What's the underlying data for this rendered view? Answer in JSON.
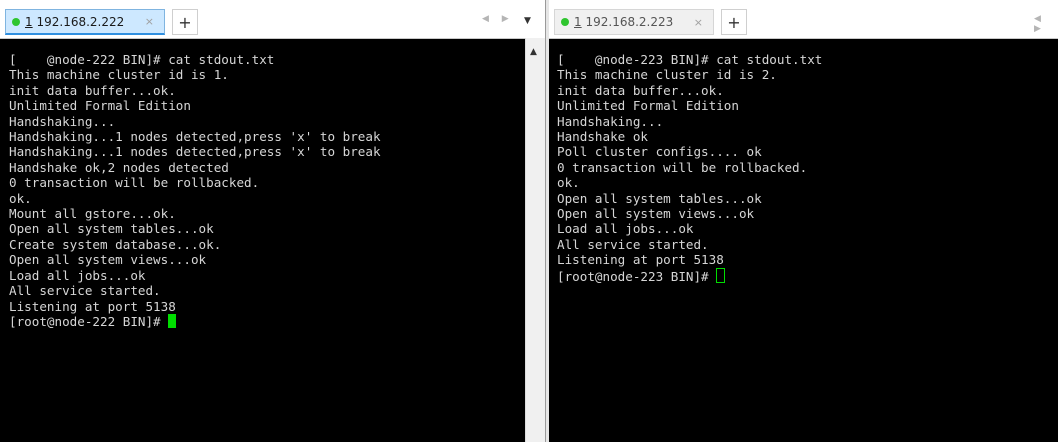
{
  "left_pane": {
    "tab": {
      "number": "1",
      "host": "192.168.2.222",
      "close": "×",
      "status_color": "#2fc52f",
      "active": true
    },
    "new_tab": "+",
    "nav": "◀ ▶",
    "dropdown": "▼",
    "scroll_up": "▲",
    "lines": [
      "[    @node-222 BIN]# cat stdout.txt",
      "This machine cluster id is 1.",
      "init data buffer...ok.",
      "Unlimited Formal Edition",
      "Handshaking...",
      "Handshaking...1 nodes detected,press 'x' to break",
      "Handshaking...1 nodes detected,press 'x' to break",
      "Handshake ok,2 nodes detected",
      "0 transaction will be rollbacked.",
      "ok.",
      "Mount all gstore...ok.",
      "Open all system tables...ok",
      "Create system database...ok.",
      "Open all system views...ok",
      "Load all jobs...ok",
      "All service started.",
      "Listening at port 5138"
    ],
    "prompt": "[root@node-222 BIN]# "
  },
  "right_pane": {
    "tab": {
      "number": "1",
      "host": "192.168.2.223",
      "close": "×",
      "status_color": "#2fc52f",
      "active": false
    },
    "new_tab": "+",
    "nav": "◀ ▶",
    "lines": [
      "[    @node-223 BIN]# cat stdout.txt",
      "This machine cluster id is 2.",
      "init data buffer...ok.",
      "Unlimited Formal Edition",
      "Handshaking...",
      "Handshake ok",
      "Poll cluster configs.... ok",
      "0 transaction will be rollbacked.",
      "ok.",
      "Open all system tables...ok",
      "Open all system views...ok",
      "Load all jobs...ok",
      "All service started.",
      "Listening at port 5138"
    ],
    "prompt": "[root@node-223 BIN]# "
  }
}
